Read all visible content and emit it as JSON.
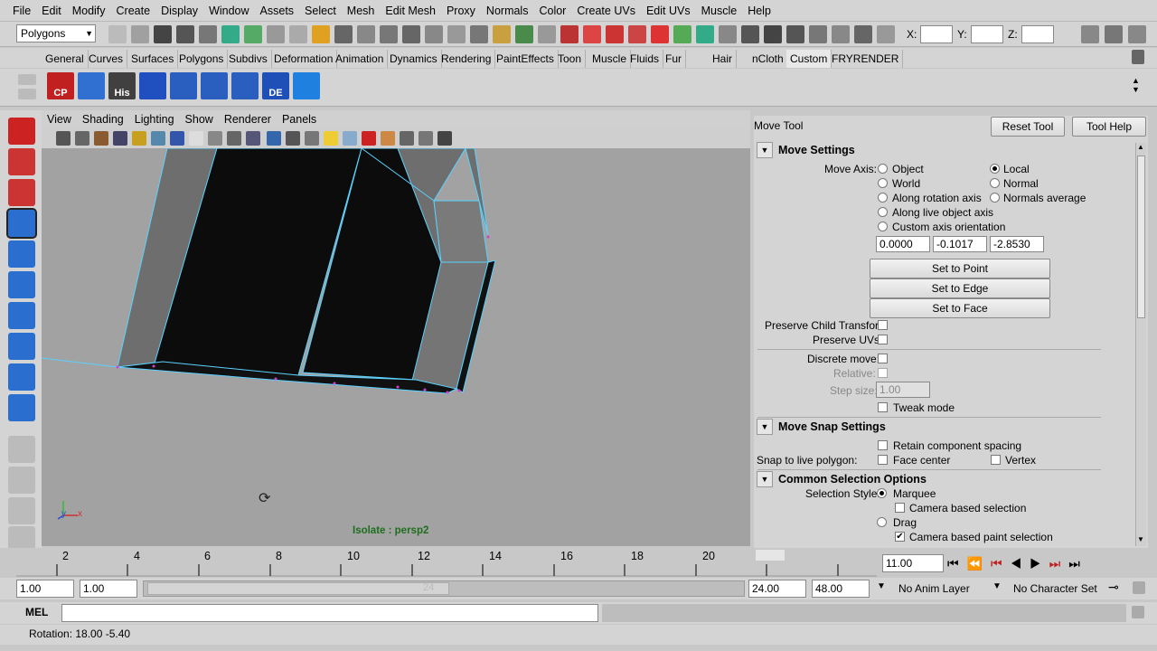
{
  "menu": [
    "File",
    "Edit",
    "Modify",
    "Create",
    "Display",
    "Window",
    "Assets",
    "Select",
    "Mesh",
    "Edit Mesh",
    "Proxy",
    "Normals",
    "Color",
    "Create UVs",
    "Edit UVs",
    "Muscle",
    "Help"
  ],
  "status": {
    "mode": "Polygons",
    "x_label": "X:",
    "y_label": "Y:",
    "z_label": "Z:"
  },
  "shelf_tabs": [
    "General",
    "Curves",
    "Surfaces",
    "Polygons",
    "Subdivs",
    "Deformation",
    "Animation",
    "Dynamics",
    "Rendering",
    "PaintEffects",
    "Toon",
    "Muscle",
    "Fluids",
    "Fur",
    "Hair",
    "nCloth",
    "Custom",
    "FRYRENDER"
  ],
  "shelf_active": "Custom",
  "shelf_icons": [
    {
      "label": "CP",
      "color": "#c02020"
    },
    {
      "label": "",
      "color": "#3070d0"
    },
    {
      "label": "His",
      "color": "#404040"
    },
    {
      "label": "",
      "color": "#2050c0"
    },
    {
      "label": "",
      "color": "#2a5fc0"
    },
    {
      "label": "",
      "color": "#2a5fc0"
    },
    {
      "label": "",
      "color": "#2a5fc0"
    },
    {
      "label": "DE",
      "color": "#1e50b8"
    },
    {
      "label": "",
      "color": "#2080e0"
    }
  ],
  "viewport": {
    "menu": [
      "View",
      "Shading",
      "Lighting",
      "Show",
      "Renderer",
      "Panels"
    ],
    "isolate_label": "Isolate : persp2",
    "axis_y": "y",
    "axis_x": "x"
  },
  "tool": {
    "title": "Move Tool",
    "reset": "Reset Tool",
    "help": "Tool Help",
    "move_settings": "Move Settings",
    "move_axis_label": "Move Axis:",
    "axis_options_left": [
      "Object",
      "World",
      "Along rotation axis",
      "Along live object axis",
      "Custom axis orientation"
    ],
    "axis_options_right": [
      "Local",
      "Normal",
      "Normals average"
    ],
    "axis_selected": "Local",
    "vec": [
      "0.0000",
      "-0.1017",
      "-2.8530"
    ],
    "set_point": "Set to Point",
    "set_edge": "Set to Edge",
    "set_face": "Set to Face",
    "preserve_child": "Preserve Child Transform",
    "preserve_uvs": "Preserve UVs",
    "discrete_move": "Discrete move:",
    "relative": "Relative:",
    "step_size": "Step size:",
    "step_value": "1.00",
    "tweak_mode": "Tweak mode",
    "snap_settings": "Move Snap Settings",
    "retain_spacing": "Retain component spacing",
    "snap_live": "Snap to live polygon:",
    "face_center": "Face center",
    "vertex": "Vertex",
    "common_sel": "Common Selection Options",
    "sel_style": "Selection Style:",
    "marquee": "Marquee",
    "camera_sel": "Camera based selection",
    "drag": "Drag",
    "camera_paint": "Camera based paint selection"
  },
  "timeline": {
    "ticks": [
      "2",
      "4",
      "6",
      "8",
      "10",
      "12",
      "14",
      "16",
      "18",
      "20"
    ],
    "current": "11.00"
  },
  "range": {
    "start": "1.00",
    "start2": "1.00",
    "end1": "24.00",
    "end2": "48.00",
    "anim_layer": "No Anim Layer",
    "char_set": "No Character Set",
    "inner_end": "24"
  },
  "command": {
    "label": "MEL"
  },
  "help": {
    "text": "Rotation: 18.00  -5.40"
  }
}
